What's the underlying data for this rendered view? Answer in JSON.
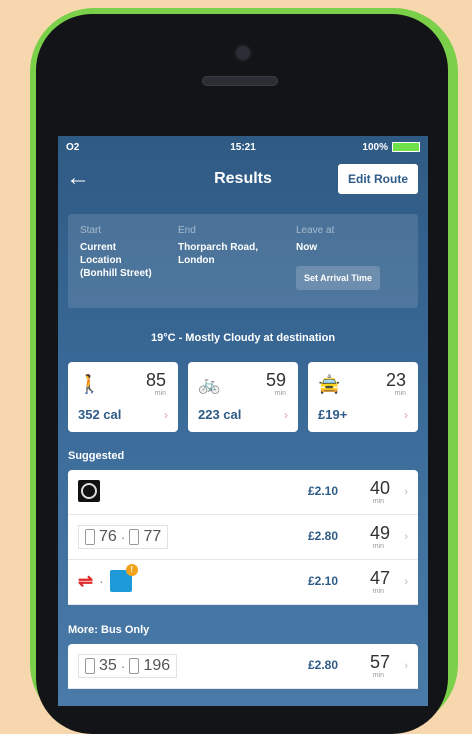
{
  "status": {
    "carrier": "O2",
    "time": "15:21",
    "battery": "100%"
  },
  "nav": {
    "back_icon": "←",
    "title": "Results",
    "edit_label": "Edit Route"
  },
  "route": {
    "start_label": "Start",
    "start_value_1": "Current",
    "start_value_2": "Location",
    "start_value_3": "(Bonhill Street)",
    "end_label": "End",
    "end_value_1": "Thorparch Road,",
    "end_value_2": "London",
    "leave_label": "Leave at",
    "leave_value": "Now",
    "arrival_button": "Set Arrival Time"
  },
  "weather": "19°C - Mostly Cloudy at destination",
  "modes": [
    {
      "name": "walk",
      "icon": "walk-icon",
      "duration": "85",
      "unit": "min",
      "cost": "352 cal"
    },
    {
      "name": "bike",
      "icon": "bike-icon",
      "duration": "59",
      "unit": "min",
      "cost": "223 cal"
    },
    {
      "name": "taxi",
      "icon": "taxi-icon",
      "duration": "23",
      "unit": "min",
      "cost": "£19+"
    }
  ],
  "suggested_label": "Suggested",
  "suggested": [
    {
      "type": "tube",
      "price": "£2.10",
      "time": "40",
      "unit": "min"
    },
    {
      "type": "bus",
      "bus_a": "76",
      "bus_b": "77",
      "price": "£2.80",
      "time": "49",
      "unit": "min"
    },
    {
      "type": "rail",
      "badge": "!",
      "price": "£2.10",
      "time": "47",
      "unit": "min"
    }
  ],
  "more_label": "More: Bus Only",
  "more": [
    {
      "bus_a": "35",
      "bus_b": "196",
      "price": "£2.80",
      "time": "57",
      "unit": "min"
    }
  ]
}
